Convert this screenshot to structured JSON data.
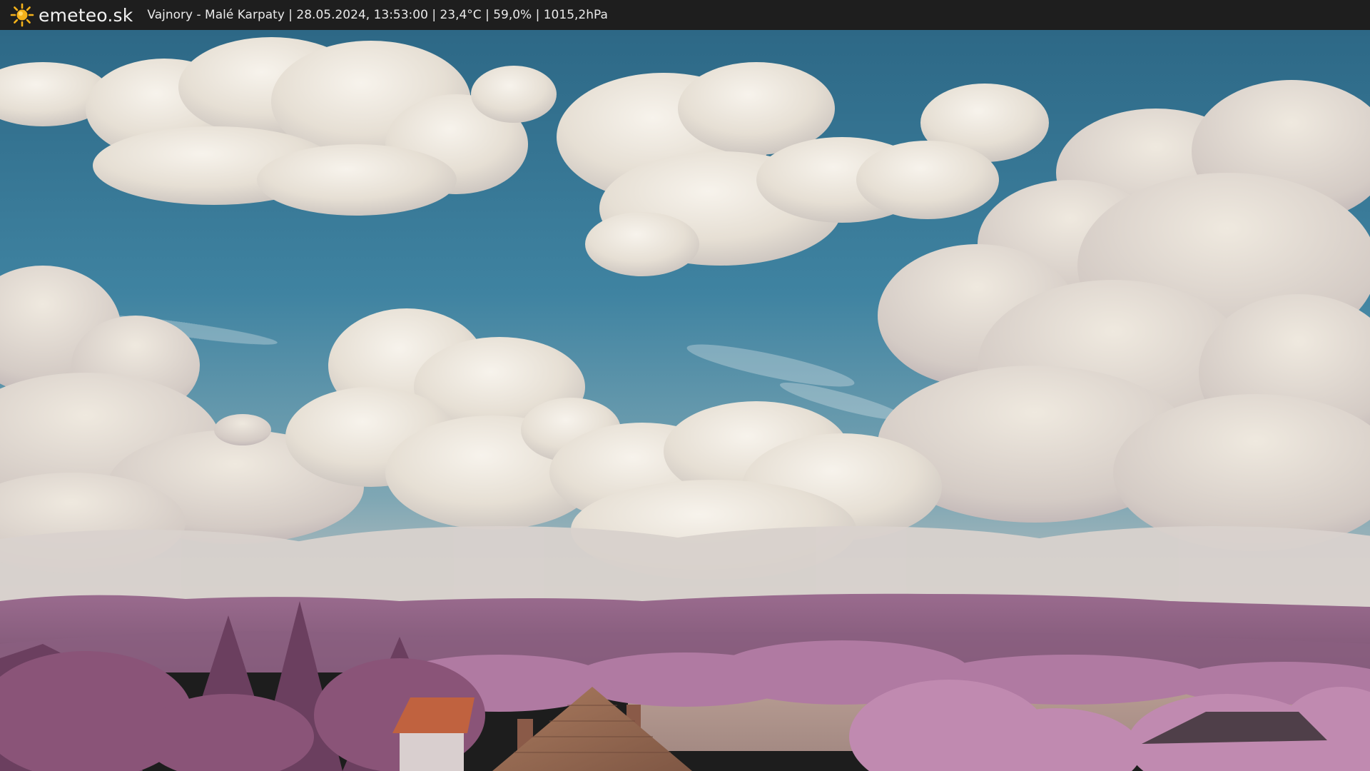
{
  "header": {
    "brand": "emeteo.sk",
    "brand_icon": "sun-icon",
    "status": "Vajnory - Malé Karpaty | 28.05.2024, 13:53:00 | 23,4°C | 59,0% | 1015,2hPa"
  },
  "colors": {
    "bar": "#1e1e1e",
    "sky_top": "#2f6b89",
    "sky_mid": "#4a8aa6",
    "cloud": "#ece6dc",
    "foliage": "#a87299",
    "roof": "#b06a45",
    "sun": "#f5b21a"
  }
}
